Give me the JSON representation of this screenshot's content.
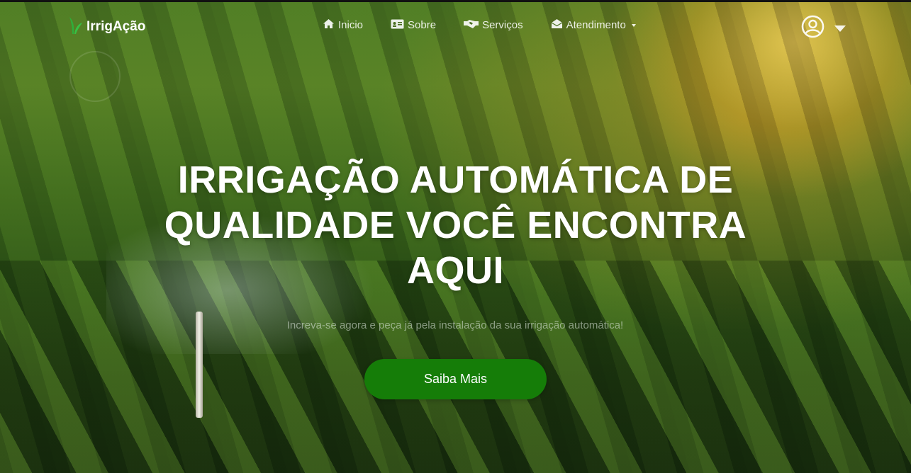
{
  "brand": {
    "name": "IrrigAção",
    "icon": "leaf-icon",
    "accent_color": "#2fae3a"
  },
  "nav": {
    "items": [
      {
        "label": "Inicio",
        "icon": "home-icon"
      },
      {
        "label": "Sobre",
        "icon": "id-card-icon"
      },
      {
        "label": "Serviços",
        "icon": "handshake-icon"
      },
      {
        "label": "Atendimento",
        "icon": "envelope-open-icon",
        "has_dropdown": true
      }
    ]
  },
  "user": {
    "icon": "user-circle-icon",
    "dropdown_icon": "caret-down-icon"
  },
  "hero": {
    "headline_line1": "IRRIGAÇÃO AUTOMÁTICA DE",
    "headline_line2": "QUALIDADE VOCÊ ENCONTRA",
    "headline_line3": "AQUI",
    "subtitle": "Increva-se agora e peça já pela instalação da sua irrigação automática!",
    "cta_label": "Saiba Mais",
    "cta_color": "#157d08"
  }
}
